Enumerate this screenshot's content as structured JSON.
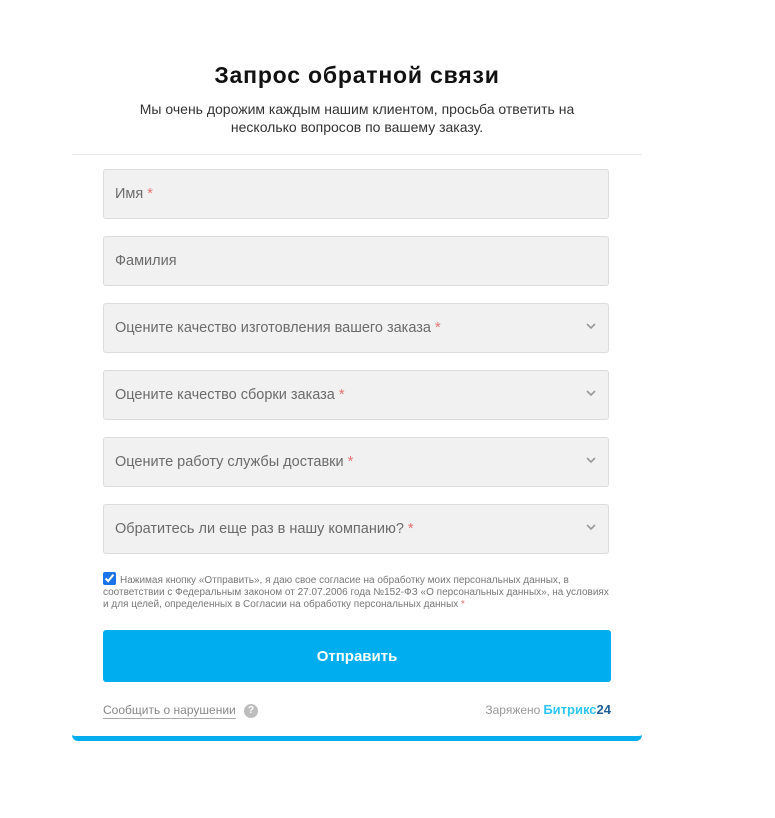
{
  "form": {
    "title": "Запрос обратной связи",
    "subtitle": "Мы очень дорожим каждым нашим клиентом, просьба ответить на несколько вопросов по вашему заказу."
  },
  "fields": {
    "first_name": {
      "placeholder": "Имя",
      "required": "*"
    },
    "last_name": {
      "placeholder": "Фамилия"
    },
    "quality_manufacturing": {
      "placeholder": "Оцените качество изготовления вашего заказа",
      "required": "*"
    },
    "quality_assembly": {
      "placeholder": "Оцените качество сборки заказа",
      "required": "*"
    },
    "delivery_service": {
      "placeholder": "Оцените работу службы доставки",
      "required": "*"
    },
    "return_again": {
      "placeholder": "Обратитесь ли еще раз в нашу компанию?",
      "required": "*"
    }
  },
  "consent": {
    "text": "Нажимая кнопку «Отправить», я даю свое согласие на обработку моих персональных данных, в соответствии с Федеральным законом от 27.07.2006 года №152-ФЗ «О персональных данных», на условиях и для целей, определенных в Согласии на обработку персональных данных",
    "required": "*",
    "checked": true
  },
  "submit_label": "Отправить",
  "footer": {
    "report_link": "Сообщить о нарушении",
    "help_icon": "?",
    "powered_label": "Заряжено",
    "brand_name": "Битрикс",
    "brand_number": "24"
  },
  "colors": {
    "accent": "#00aeef",
    "field_bg": "#f1f1f1",
    "required": "#e57373",
    "brand_light": "#2fc6f6",
    "brand_dark": "#215f98"
  }
}
